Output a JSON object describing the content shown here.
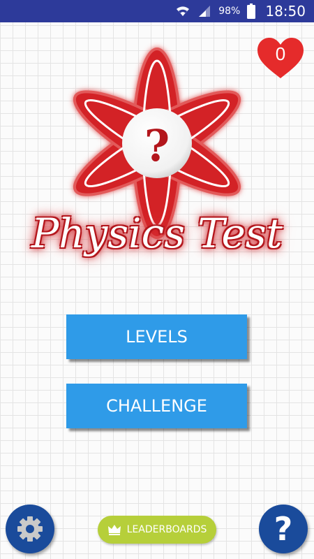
{
  "status_bar": {
    "battery": "98%",
    "time": "18:50",
    "icons": [
      "wifi-icon",
      "signal-icon",
      "battery-icon"
    ]
  },
  "lives": {
    "count": "0",
    "icon": "heart-icon"
  },
  "logo": {
    "title": "Physics Test",
    "center_glyph": "?"
  },
  "menu": {
    "levels_label": "LEVELS",
    "challenge_label": "CHALLENGE"
  },
  "bottom": {
    "leaderboards_label": "LEADERBOARDS",
    "settings_icon": "gear-icon",
    "help_glyph": "?"
  },
  "colors": {
    "status_bar": "#2d3a9a",
    "button_blue": "#2f9be8",
    "round_button": "#1a4b9b",
    "leaderboards_green": "#b6cf3a",
    "logo_red": "#c8161f"
  }
}
